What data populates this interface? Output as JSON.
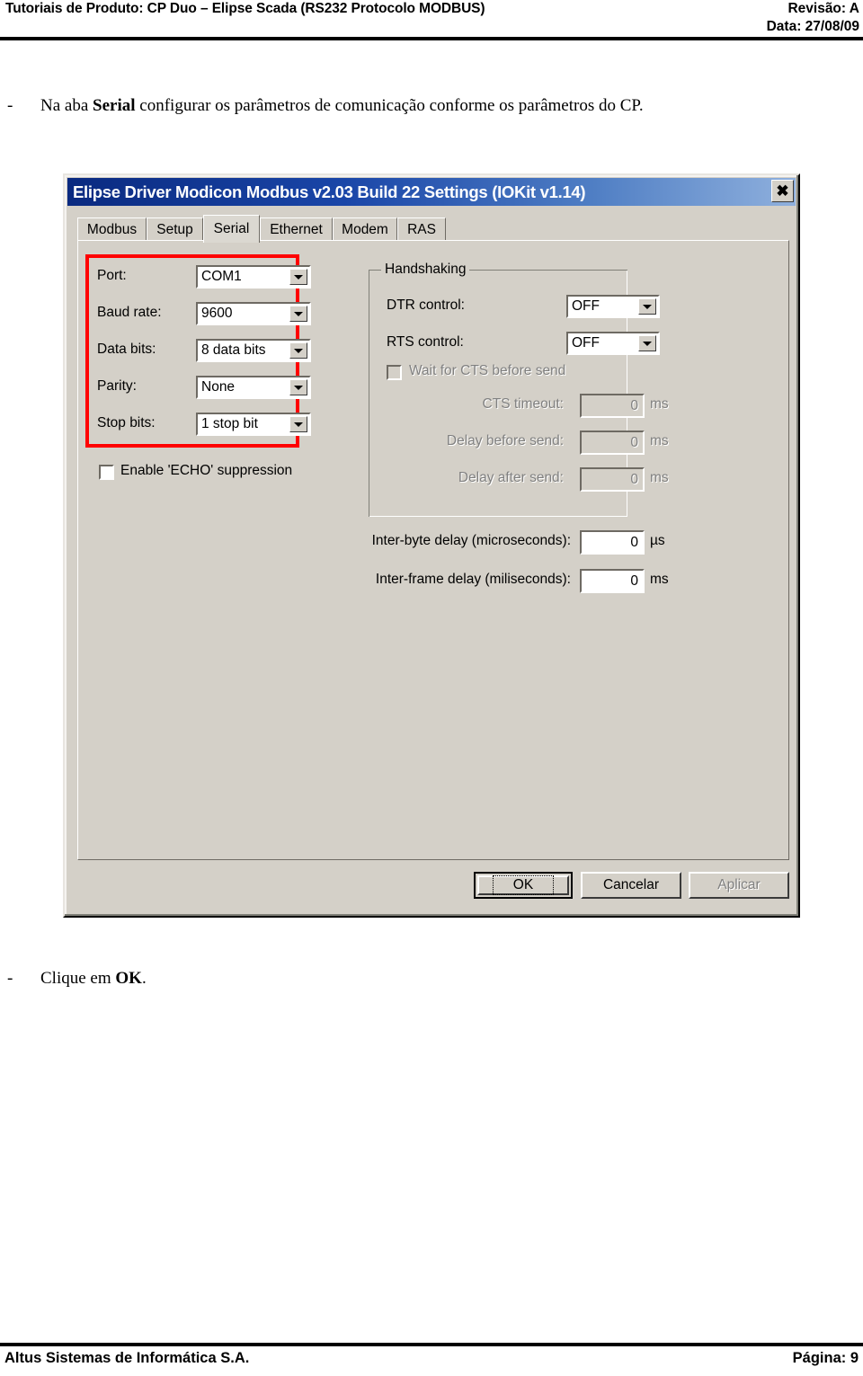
{
  "page_header": {
    "title": "Tutoriais de Produto: CP Duo – Elipse Scada (RS232 Protocolo MODBUS)",
    "revision": "Revisão: A",
    "date": "Data: 27/08/09"
  },
  "page_footer": {
    "company": "Altus Sistemas de Informática S.A.",
    "page": "Página: 9"
  },
  "document": {
    "intro_dash": "-",
    "intro_part1": "Na aba ",
    "intro_bold": "Serial",
    "intro_part2": " configurar os parâmetros de comunicação conforme os parâmetros do CP.",
    "outro_dash": "-",
    "outro_part1": "Clique em ",
    "outro_bold": "OK",
    "outro_part2": "."
  },
  "dialog": {
    "title": "Elipse Driver Modicon Modbus v2.03 Build 22 Settings (IOKit v1.14)",
    "close_glyph": "✖",
    "tabs": [
      {
        "label": "Modbus",
        "selected": false
      },
      {
        "label": "Setup",
        "selected": false
      },
      {
        "label": "Serial",
        "selected": true
      },
      {
        "label": "Ethernet",
        "selected": false
      },
      {
        "label": "Modem",
        "selected": false
      },
      {
        "label": "RAS",
        "selected": false
      }
    ],
    "serial": {
      "port": {
        "label": "Port:",
        "value": "COM1"
      },
      "baud_rate": {
        "label": "Baud rate:",
        "value": "9600"
      },
      "data_bits": {
        "label": "Data bits:",
        "value": "8 data bits"
      },
      "parity": {
        "label": "Parity:",
        "value": "None"
      },
      "stop_bits": {
        "label": "Stop bits:",
        "value": "1 stop bit"
      },
      "echo_suppression": {
        "label": "Enable 'ECHO' suppression",
        "checked": false
      }
    },
    "handshaking": {
      "legend": "Handshaking",
      "dtr_control": {
        "label": "DTR control:",
        "value": "OFF"
      },
      "rts_control": {
        "label": "RTS control:",
        "value": "OFF"
      },
      "wait_cts": {
        "label": "Wait for CTS before send",
        "checked": false
      },
      "cts_timeout": {
        "label": "CTS timeout:",
        "value": "0",
        "unit": "ms"
      },
      "delay_before_send": {
        "label": "Delay before send:",
        "value": "0",
        "unit": "ms"
      },
      "delay_after_send": {
        "label": "Delay after send:",
        "value": "0",
        "unit": "ms"
      }
    },
    "timing": {
      "inter_byte": {
        "label": "Inter-byte delay (microseconds):",
        "value": "0",
        "unit": "µs"
      },
      "inter_frame": {
        "label": "Inter-frame delay (miliseconds):",
        "value": "0",
        "unit": "ms"
      }
    },
    "buttons": {
      "ok": "OK",
      "cancel": "Cancelar",
      "apply": "Aplicar"
    }
  },
  "colors": {
    "dialog_face": "#d4d0c8",
    "titlebar_start": "#0a2a80",
    "titlebar_end": "#8fb0dd",
    "highlight_red": "#ff0000",
    "disabled_text": "#808080"
  }
}
